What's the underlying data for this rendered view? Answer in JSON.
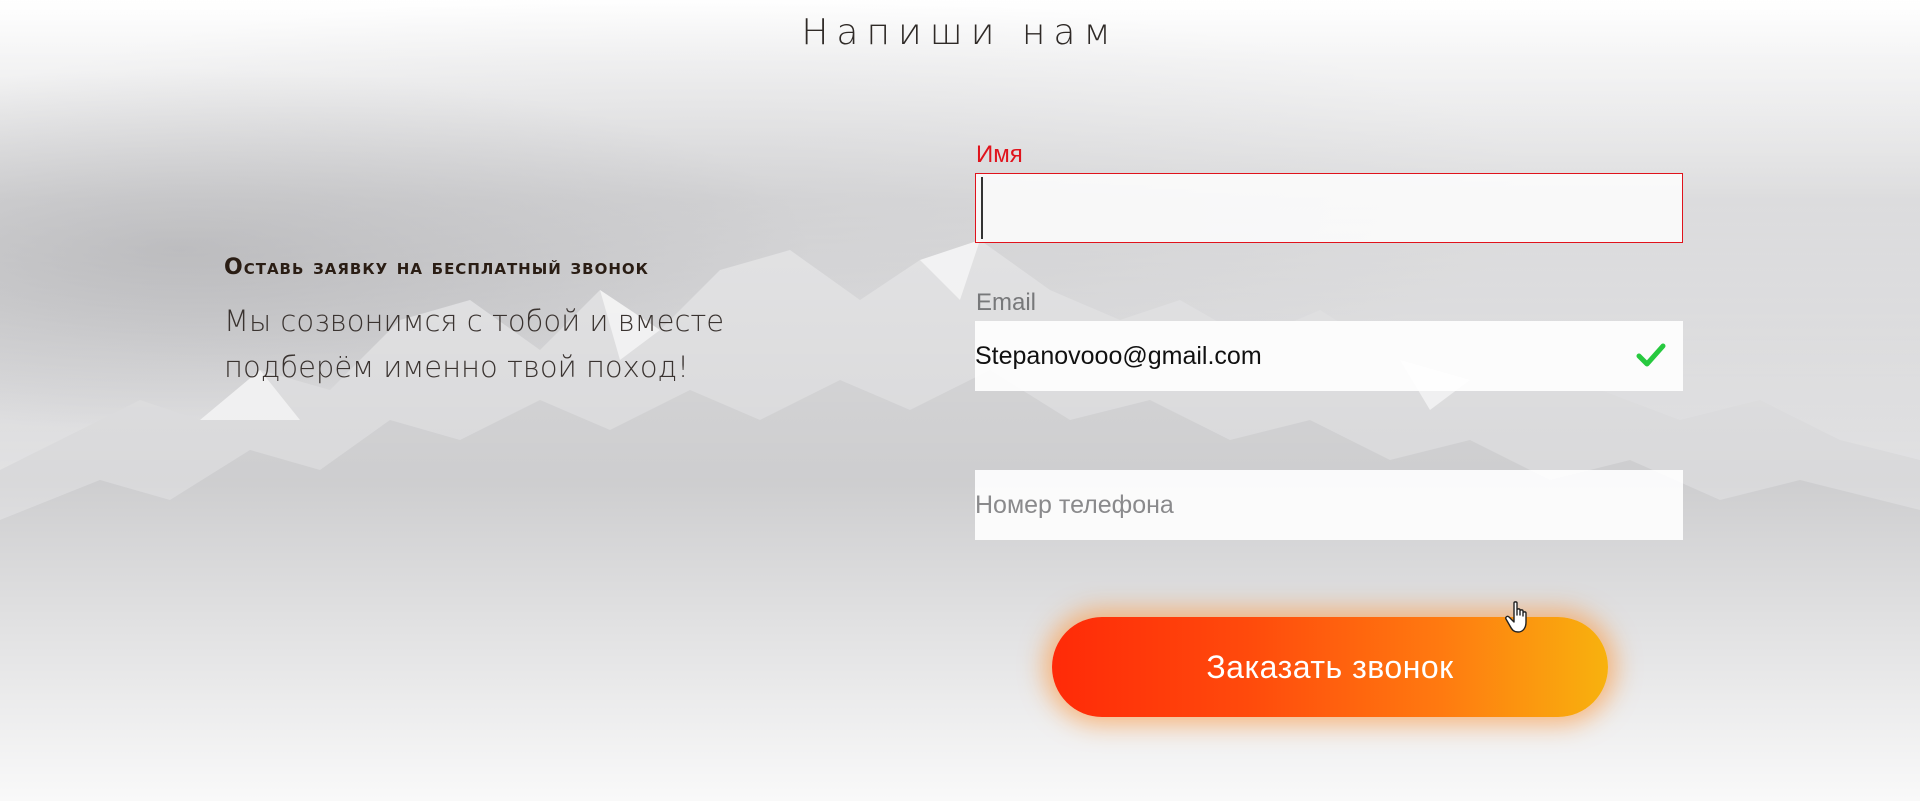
{
  "header": {
    "title": "Напиши нам"
  },
  "intro": {
    "heading": "Оставь заявку на бесплатный звонок",
    "text_line1": "Мы созвонимся с  тобой и вместе",
    "text_line2": "подберём именно твой поход!"
  },
  "form": {
    "name": {
      "label": "Имя",
      "value": "",
      "state": "error"
    },
    "email": {
      "label": "Email",
      "value": "Stepanovooo@gmail.com",
      "state": "valid"
    },
    "phone": {
      "placeholder": "Номер телефона",
      "value": ""
    },
    "submit_label": "Заказать звонок"
  },
  "icons": {
    "valid": "check-icon",
    "pointer": "hand-cursor-icon"
  },
  "colors": {
    "error": "#e0131c",
    "valid": "#27c93f",
    "button_start": "#ff2a08",
    "button_end": "#f8b20e"
  }
}
